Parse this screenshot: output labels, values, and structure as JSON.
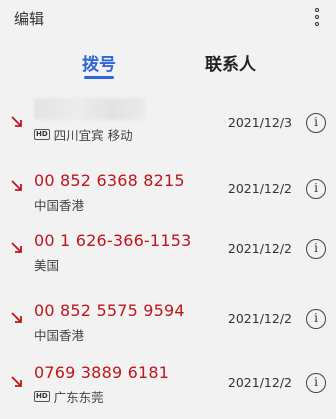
{
  "topbar": {
    "edit_label": "编辑",
    "more_icon": "more-vertical-icon"
  },
  "tabs": [
    {
      "label": "拨号",
      "active": true
    },
    {
      "label": "联系人",
      "active": false
    }
  ],
  "accent_color": "#2f66d8",
  "missed_color": "#c0151b",
  "calls": [
    {
      "number": "",
      "hd": true,
      "location": "四川宜宾 移动",
      "date": "2021/12/3"
    },
    {
      "number": "00 852 6368 8215",
      "hd": false,
      "location": "中国香港",
      "date": "2021/12/2"
    },
    {
      "number": "00 1 626-366-1153",
      "hd": false,
      "location": "美国",
      "date": "2021/12/2"
    },
    {
      "number": "00 852 5575 9594",
      "hd": false,
      "location": "中国香港",
      "date": "2021/12/2"
    },
    {
      "number": "0769 3889 6181",
      "hd": true,
      "location": "广东东莞",
      "date": "2021/12/2"
    }
  ],
  "hd_label": "HD",
  "info_symbol": "i"
}
